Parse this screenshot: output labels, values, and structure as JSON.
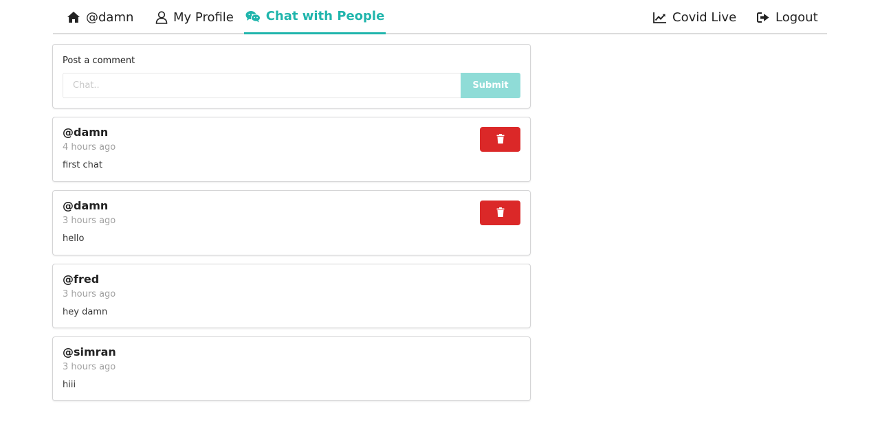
{
  "nav": {
    "home_label": "@damn",
    "profile_label": "My Profile",
    "chat_label": "Chat with People",
    "covid_label": "Covid Live",
    "logout_label": "Logout",
    "active_color": "#1fb5ac"
  },
  "composer": {
    "label": "Post a comment",
    "placeholder": "Chat..",
    "value": "",
    "submit_label": "Submit",
    "submit_color": "#8fdcd7"
  },
  "comments": [
    {
      "author": "@damn",
      "time": "4 hours ago",
      "text": "first chat",
      "deletable": true
    },
    {
      "author": "@damn",
      "time": "3 hours ago",
      "text": "hello",
      "deletable": true
    },
    {
      "author": "@fred",
      "time": "3 hours ago",
      "text": "hey damn",
      "deletable": false
    },
    {
      "author": "@simran",
      "time": "3 hours ago",
      "text": "hiii",
      "deletable": false
    }
  ],
  "colors": {
    "delete_button": "#db2828",
    "muted_text": "#a0a0a0"
  },
  "icons": {
    "home": "home-icon",
    "profile": "user-icon",
    "chat": "wechat-icon",
    "covid": "line-chart-icon",
    "logout": "sign-out-icon",
    "delete": "trash-icon"
  }
}
